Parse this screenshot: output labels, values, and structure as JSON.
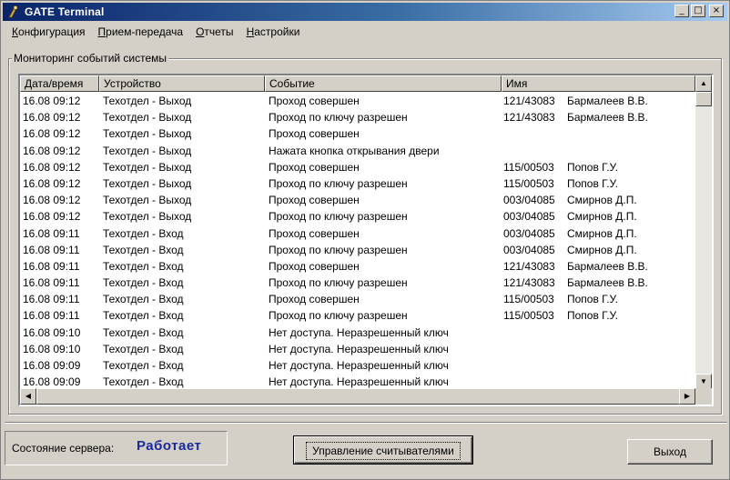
{
  "window": {
    "title": "GATE Terminal"
  },
  "titlebar_buttons": {
    "minimize": "_",
    "maximize": "□",
    "close": "×"
  },
  "menu": [
    "Конфигурация",
    "Прием-передача",
    "Отчеты",
    "Настройки"
  ],
  "group": {
    "title": "Мониторинг событий системы"
  },
  "columns": {
    "date": "Дата/время",
    "device": "Устройство",
    "event": "Событие",
    "name": "Имя"
  },
  "rows": [
    {
      "date": "16.08  09:12",
      "device": "Техотдел - Выход",
      "event": "Проход совершен",
      "code": "121/43083",
      "person": "Бармалеев В.В."
    },
    {
      "date": "16.08  09:12",
      "device": "Техотдел - Выход",
      "event": "Проход по ключу разрешен",
      "code": "121/43083",
      "person": "Бармалеев В.В."
    },
    {
      "date": "16.08  09:12",
      "device": "Техотдел - Выход",
      "event": "Проход совершен",
      "code": "",
      "person": ""
    },
    {
      "date": "16.08  09:12",
      "device": "Техотдел - Выход",
      "event": "Нажата кнопка открывания двери",
      "code": "",
      "person": ""
    },
    {
      "date": "16.08  09:12",
      "device": "Техотдел - Выход",
      "event": "Проход совершен",
      "code": "115/00503",
      "person": "Попов Г.У."
    },
    {
      "date": "16.08  09:12",
      "device": "Техотдел - Выход",
      "event": "Проход по ключу разрешен",
      "code": "115/00503",
      "person": "Попов Г.У."
    },
    {
      "date": "16.08  09:12",
      "device": "Техотдел - Выход",
      "event": "Проход совершен",
      "code": "003/04085",
      "person": "Смирнов Д.П."
    },
    {
      "date": "16.08  09:12",
      "device": "Техотдел - Выход",
      "event": "Проход по ключу разрешен",
      "code": "003/04085",
      "person": "Смирнов Д.П."
    },
    {
      "date": "16.08  09:11",
      "device": "Техотдел - Вход",
      "event": "Проход совершен",
      "code": "003/04085",
      "person": "Смирнов Д.П."
    },
    {
      "date": "16.08  09:11",
      "device": "Техотдел - Вход",
      "event": "Проход по ключу разрешен",
      "code": "003/04085",
      "person": "Смирнов Д.П."
    },
    {
      "date": "16.08  09:11",
      "device": "Техотдел - Вход",
      "event": "Проход совершен",
      "code": "121/43083",
      "person": "Бармалеев В.В."
    },
    {
      "date": "16.08  09:11",
      "device": "Техотдел - Вход",
      "event": "Проход по ключу разрешен",
      "code": "121/43083",
      "person": "Бармалеев В.В."
    },
    {
      "date": "16.08  09:11",
      "device": "Техотдел - Вход",
      "event": "Проход совершен",
      "code": "115/00503",
      "person": "Попов Г.У."
    },
    {
      "date": "16.08  09:11",
      "device": "Техотдел - Вход",
      "event": "Проход по ключу разрешен",
      "code": "115/00503",
      "person": "Попов Г.У."
    },
    {
      "date": "16.08  09:10",
      "device": "Техотдел - Вход",
      "event": "Нет доступа. Неразрешенный ключ",
      "code": "",
      "person": ""
    },
    {
      "date": "16.08  09:10",
      "device": "Техотдел - Вход",
      "event": "Нет доступа. Неразрешенный ключ",
      "code": "",
      "person": ""
    },
    {
      "date": "16.08  09:09",
      "device": "Техотдел - Вход",
      "event": "Нет доступа. Неразрешенный ключ",
      "code": "",
      "person": ""
    },
    {
      "date": "16.08  09:09",
      "device": "Техотдел - Вход",
      "event": "Нет доступа. Неразрешенный ключ",
      "code": "",
      "person": ""
    }
  ],
  "status": {
    "label": "Состояние сервера:",
    "value": "Работает",
    "value_color": "#1a2a9a"
  },
  "buttons": {
    "readers": "Управление считывателями",
    "exit": "Выход"
  },
  "icons": {
    "app": "gate-app-icon"
  }
}
